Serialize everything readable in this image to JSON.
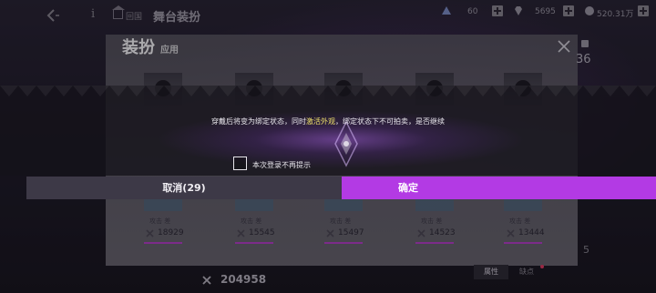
{
  "header": {
    "home_label": "回国",
    "title": "舞台装扮",
    "resources": [
      {
        "icon": "blue-gem-icon",
        "value": "60"
      },
      {
        "icon": "diamond-icon",
        "value": "5695"
      },
      {
        "icon": "coin-icon",
        "value": "520.31万"
      }
    ]
  },
  "panel": {
    "title": "装扮",
    "title_sub": "应用",
    "right_number": "36",
    "cards": [
      {
        "label": "攻击 差",
        "score": "18929"
      },
      {
        "label": "攻击 差",
        "score": "15545"
      },
      {
        "label": "攻击 差",
        "score": "15497"
      },
      {
        "label": "攻击 差",
        "score": "14523"
      },
      {
        "label": "攻击 差",
        "score": "13444"
      }
    ],
    "total_score": "204958",
    "side_number": "5",
    "attr_tab": "属性",
    "flaw_tab": "缺点"
  },
  "dialog": {
    "message_before": "穿戴后将变为绑定状态，同时",
    "message_highlight": "激活外观",
    "message_after": "，绑定状态下不可拍卖，是否继续",
    "checkbox_label": "本次登录不再提示",
    "checkbox_checked": false,
    "cancel_label": "取消(29)",
    "confirm_label": "确定"
  },
  "colors": {
    "confirm": "#b33ae4",
    "cancel": "#3d3947",
    "highlight": "#f1e36c",
    "accent_line": "#b83ecb"
  }
}
